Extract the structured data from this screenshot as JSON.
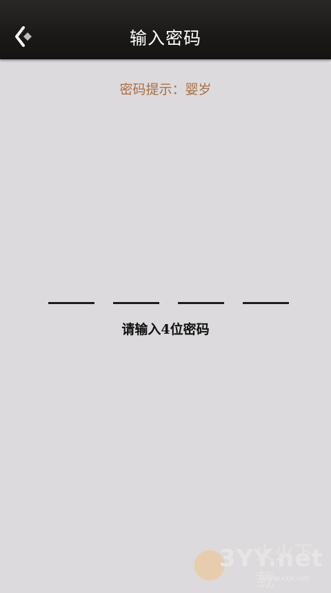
{
  "header": {
    "back_icon": "chevron-left-diamond-icon",
    "title": "输入密码",
    "background_color": "#1a1918"
  },
  "password_hint": {
    "text": "密码提示：婴岁",
    "color": "#a86e43"
  },
  "pin_entry": {
    "digit_count": 4,
    "slots": [
      "",
      "",
      "",
      ""
    ],
    "instruction": "请输入4位密码"
  },
  "watermark": {
    "brand": "3YY.net",
    "cn_text": "火火下载",
    "url": "www.kkx.net"
  }
}
